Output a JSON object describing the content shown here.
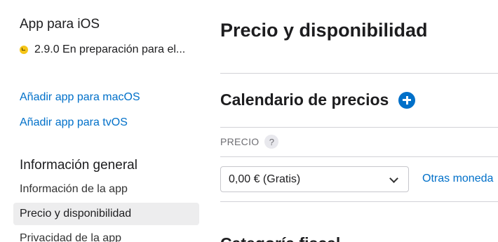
{
  "sidebar": {
    "app_title": "App para iOS",
    "status": {
      "text": "2.9.0 En preparación para el...",
      "color": "#f5c518"
    },
    "links": {
      "add_macos": "Añadir app para macOS",
      "add_tvos": "Añadir app para tvOS"
    },
    "section_title": "Información general",
    "items": [
      {
        "label": "Información de la app"
      },
      {
        "label": "Precio y disponibilidad",
        "selected": true
      },
      {
        "label": "Privacidad de la app"
      }
    ]
  },
  "main": {
    "page_title": "Precio y disponibilidad",
    "pricing": {
      "title": "Calendario de precios",
      "column_label": "PRECIO",
      "help_glyph": "?",
      "selected_price": "0,00 € (Gratis)",
      "other_currencies_link": "Otras moneda"
    },
    "next_section_title": "Categoría fiscal"
  },
  "colors": {
    "accent": "#0070c9",
    "selected_bg": "#ededee",
    "divider": "#d2d2d7"
  }
}
